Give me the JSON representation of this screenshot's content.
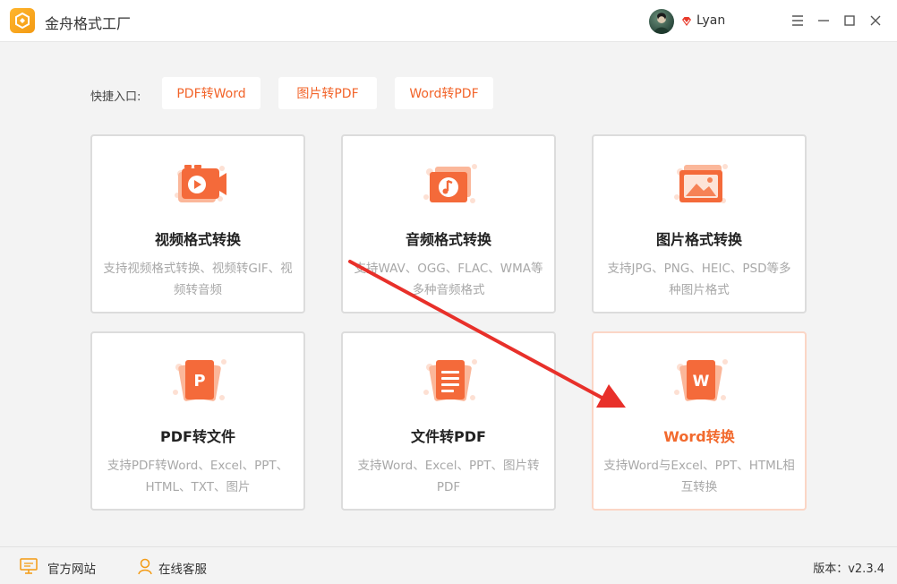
{
  "app": {
    "title": "金舟格式工厂"
  },
  "user": {
    "name": "Lyan"
  },
  "quick": {
    "label": "快捷入口:",
    "buttons": [
      "PDF转Word",
      "图片转PDF",
      "Word转PDF"
    ]
  },
  "cards": [
    {
      "title": "视频格式转换",
      "desc": "支持视频格式转换、视频转GIF、视频转音频",
      "icon": "video-icon"
    },
    {
      "title": "音频格式转换",
      "desc": "支持WAV、OGG、FLAC、WMA等多种音频格式",
      "icon": "music-icon"
    },
    {
      "title": "图片格式转换",
      "desc": "支持JPG、PNG、HEIC、PSD等多种图片格式",
      "icon": "image-icon"
    },
    {
      "title": "PDF转文件",
      "desc": "支持PDF转Word、Excel、PPT、HTML、TXT、图片",
      "icon": "ppt-p-icon"
    },
    {
      "title": "文件转PDF",
      "desc": "支持Word、Excel、PPT、图片转PDF",
      "icon": "document-icon"
    },
    {
      "title": "Word转换",
      "desc": "支持Word与Excel、PPT、HTML相互转换",
      "icon": "word-w-icon"
    }
  ],
  "footer": {
    "website": "官方网站",
    "support": "在线客服",
    "version": "版本：v2.3.4"
  },
  "colors": {
    "accent": "#f26a2e",
    "annotation": "#e8302a"
  }
}
